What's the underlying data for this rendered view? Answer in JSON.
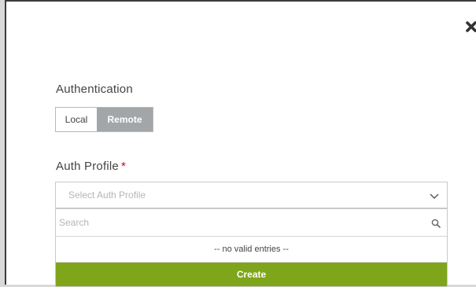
{
  "authentication": {
    "label": "Authentication",
    "options": [
      {
        "label": "Local",
        "selected": false
      },
      {
        "label": "Remote",
        "selected": true
      }
    ]
  },
  "auth_profile": {
    "label": "Auth Profile",
    "required_mark": "*",
    "placeholder": "Select Auth Profile",
    "search_placeholder": "Search",
    "empty_message": "-- no valid entries --",
    "create_label": "Create"
  },
  "icons": {
    "close": "close-icon",
    "chevron": "chevron-down-icon",
    "search": "search-icon"
  },
  "colors": {
    "accent_green": "#7fa51a",
    "selected_segment": "#a3a6a9",
    "required": "#d0021b"
  }
}
